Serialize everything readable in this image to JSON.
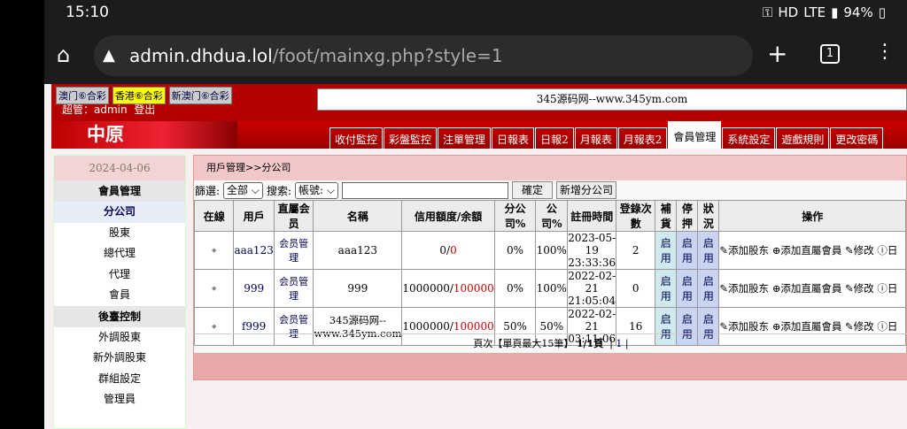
{
  "status": {
    "time": "15:10",
    "hd": "HD",
    "lte": "LTE",
    "battery": "94%"
  },
  "browser": {
    "url_host": "admin.dhdua.lol",
    "url_path": "/foot/mainxg.php?style=1",
    "tab_count": "1"
  },
  "lottery": [
    "澳门⑥合彩",
    "香港⑥合彩",
    "新澳门⑥合彩"
  ],
  "user": {
    "text": "超管：admin",
    "logout": "登出"
  },
  "marquee": "345源码网--www.345ym.com",
  "logo": "中原",
  "nav": [
    "收付監控",
    "彩盤監控",
    "注單管理",
    "日報表",
    "日報2",
    "月報表",
    "月報表2",
    "會員管理",
    "系統設定",
    "遊戲規則",
    "更改密碼"
  ],
  "sidebar": {
    "date": "2024-04-06",
    "sec1": "會員管理",
    "sec1_items": [
      "分公司",
      "股東",
      "總代理",
      "代理",
      "會員"
    ],
    "sec2": "後臺控制",
    "sec2_items": [
      "外調股東",
      "新外調股東",
      "群組設定",
      "管理員"
    ]
  },
  "crumb": "用戶管理>>分公司",
  "filter": {
    "label": "篩選:",
    "select": "全部",
    "search_label": "搜索:",
    "field": "帳號:",
    "confirm": "確定",
    "add": "新增分公司"
  },
  "table": {
    "headers": [
      "在線",
      "用戶",
      "直屬会员",
      "名稱",
      "信用額度/余額",
      "分公司%",
      "公司%",
      "註冊時間",
      "登錄次數",
      "補貨",
      "停押",
      "狀況",
      "操作"
    ],
    "rows": [
      {
        "online": "◆",
        "user": "aaa123",
        "direct": "会员管理",
        "name": "aaa123",
        "credit": "0",
        "balance": "0",
        "branch": "0%",
        "company": "100%",
        "t1": "2023-05-",
        "t2": "19",
        "t3": "23:33:36",
        "logins": "2",
        "a": "启用",
        "b": "启用",
        "c": "启用"
      },
      {
        "online": "◆",
        "user": "999",
        "direct": "会员管理",
        "name": "999",
        "credit": "1000000",
        "balance": "100000",
        "branch": "0%",
        "company": "100%",
        "t1": "2022-02-",
        "t2": "21",
        "t3": "21:05:04",
        "logins": "0",
        "a": "启用",
        "b": "启用",
        "c": "启用"
      },
      {
        "online": "◆",
        "user": "f999",
        "direct": "会员管理",
        "name": "345源码网--www.345ym.com",
        "credit": "1000000",
        "balance": "100000",
        "branch": "50%",
        "company": "50%",
        "t1": "2022-02-",
        "t2": "21",
        "t3": "03:11:06",
        "logins": "16",
        "a": "启用",
        "b": "启用",
        "c": "启用"
      }
    ],
    "ops": [
      "添加股东",
      "添加直屬會員",
      "修改",
      "日"
    ]
  },
  "pager": {
    "text": "頁次【單頁最大15筆】",
    "pages": "1/1頁",
    "link": "1"
  }
}
